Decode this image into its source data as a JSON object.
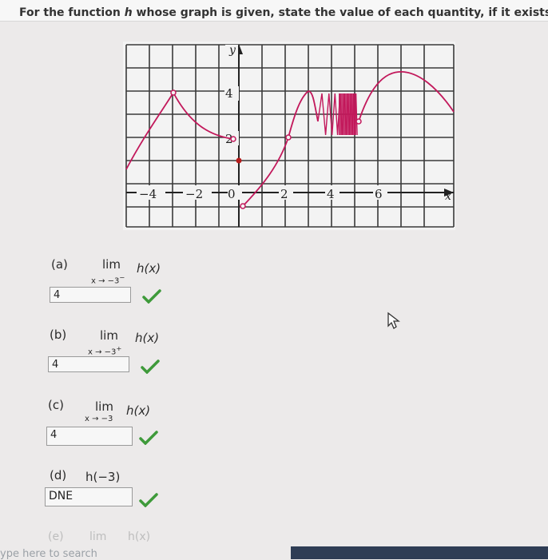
{
  "question": {
    "before": "For the function ",
    "fn_letter": "h",
    "after": " whose graph is given, state the value of each quantity, if it exists."
  },
  "graph": {
    "y_axis_label": "y",
    "x_axis_label": "x",
    "y_ticks": [
      "4",
      "2"
    ],
    "x_ticks": [
      "−4",
      "−2",
      "0",
      "2",
      "4",
      "6"
    ]
  },
  "parts": [
    {
      "label": "(a)",
      "lim": "lim",
      "sub": "x → −3",
      "sup": "−",
      "fn": "h(x)",
      "answer": "4"
    },
    {
      "label": "(b)",
      "lim": "lim",
      "sub": "x → −3",
      "sup": "+",
      "fn": "h(x)",
      "answer": "4"
    },
    {
      "label": "(c)",
      "lim": "lim",
      "sub": "x → −3",
      "sup": "",
      "fn": "h(x)",
      "answer": "4"
    },
    {
      "label": "(d)",
      "fn": "h(−3)",
      "answer": "DNE"
    }
  ],
  "faded": {
    "label": "(e)",
    "lim": "lim",
    "fn": "h(x)"
  },
  "taskbar": {
    "search_text": "ype here to search"
  },
  "colors": {
    "curve": "#c2185b",
    "point": "#b71c1c",
    "check": "#3e9a3a",
    "grid": "#3a3a3a"
  }
}
